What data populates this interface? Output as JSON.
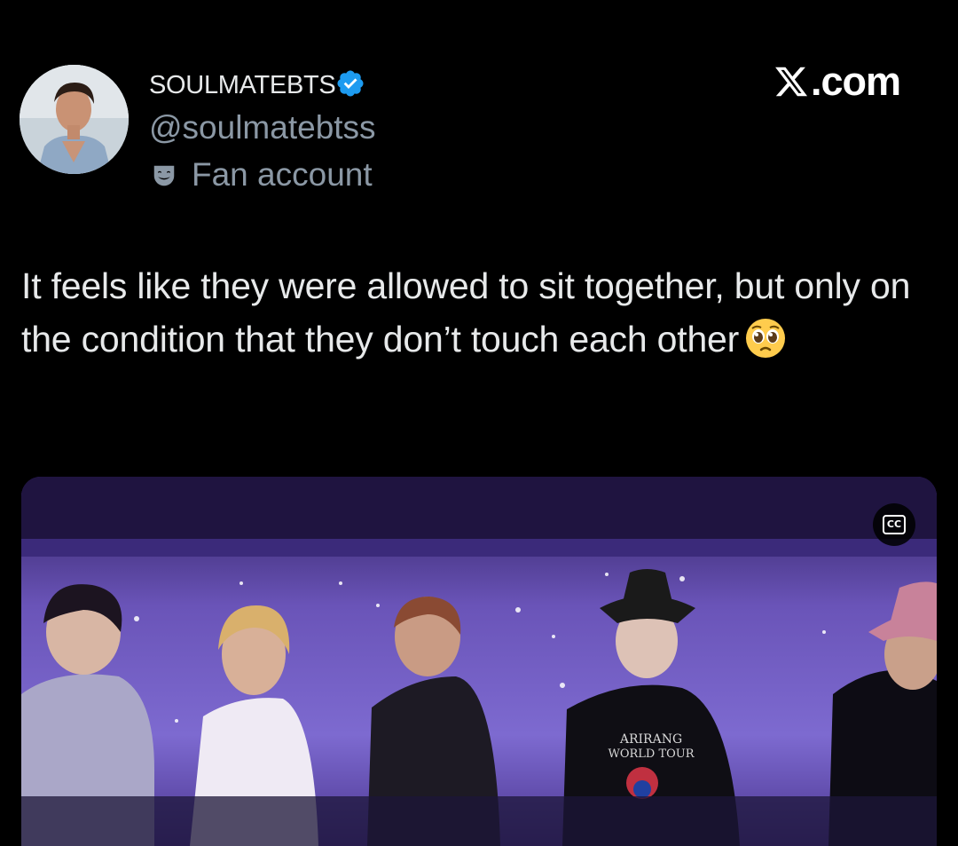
{
  "author": {
    "display_name": "SOULMATEBTS",
    "handle": "@soulmatebtss",
    "label": "Fan account",
    "verified": true,
    "verified_color": "#1d9bf0"
  },
  "brand": {
    "text": ".com",
    "icon": "x-logo-icon"
  },
  "tweet": {
    "text": "It feels like they were allowed to sit together, but only on the condition that they don’t touch each other",
    "emoji": "pleading-face"
  },
  "media": {
    "type": "video",
    "cc_label": "CC",
    "shirt_text_line1": "ARIRANG",
    "shirt_text_line2": "WORLD TOUR"
  }
}
